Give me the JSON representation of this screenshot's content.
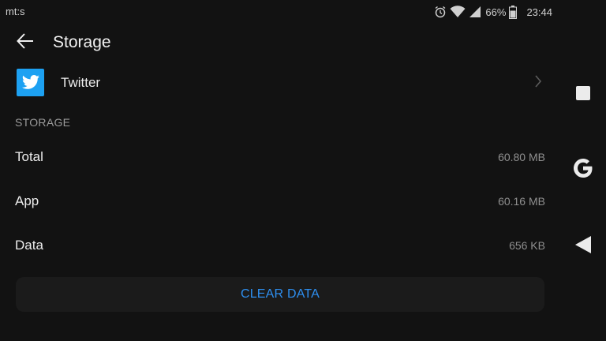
{
  "status_bar": {
    "carrier": "mt:s",
    "battery_percent": "66%",
    "time": "23:44",
    "icons": [
      "alarm-icon",
      "wifi-icon",
      "signal-icon",
      "battery-icon"
    ]
  },
  "toolbar": {
    "title": "Storage",
    "back_icon": "back-arrow-icon"
  },
  "app": {
    "name": "Twitter",
    "icon": "twitter-bird-icon",
    "icon_color": "#1da1f2"
  },
  "storage": {
    "header": "STORAGE",
    "rows": [
      {
        "label": "Total",
        "value": "60.80 MB"
      },
      {
        "label": "App",
        "value": "60.16 MB"
      },
      {
        "label": "Data",
        "value": "656 KB"
      }
    ]
  },
  "actions": {
    "clear_data_label": "CLEAR DATA",
    "accent_color": "#2e8ff0"
  },
  "nav_bar": {
    "buttons": [
      "recents-square-icon",
      "google-g-icon",
      "back-triangle-icon"
    ]
  }
}
